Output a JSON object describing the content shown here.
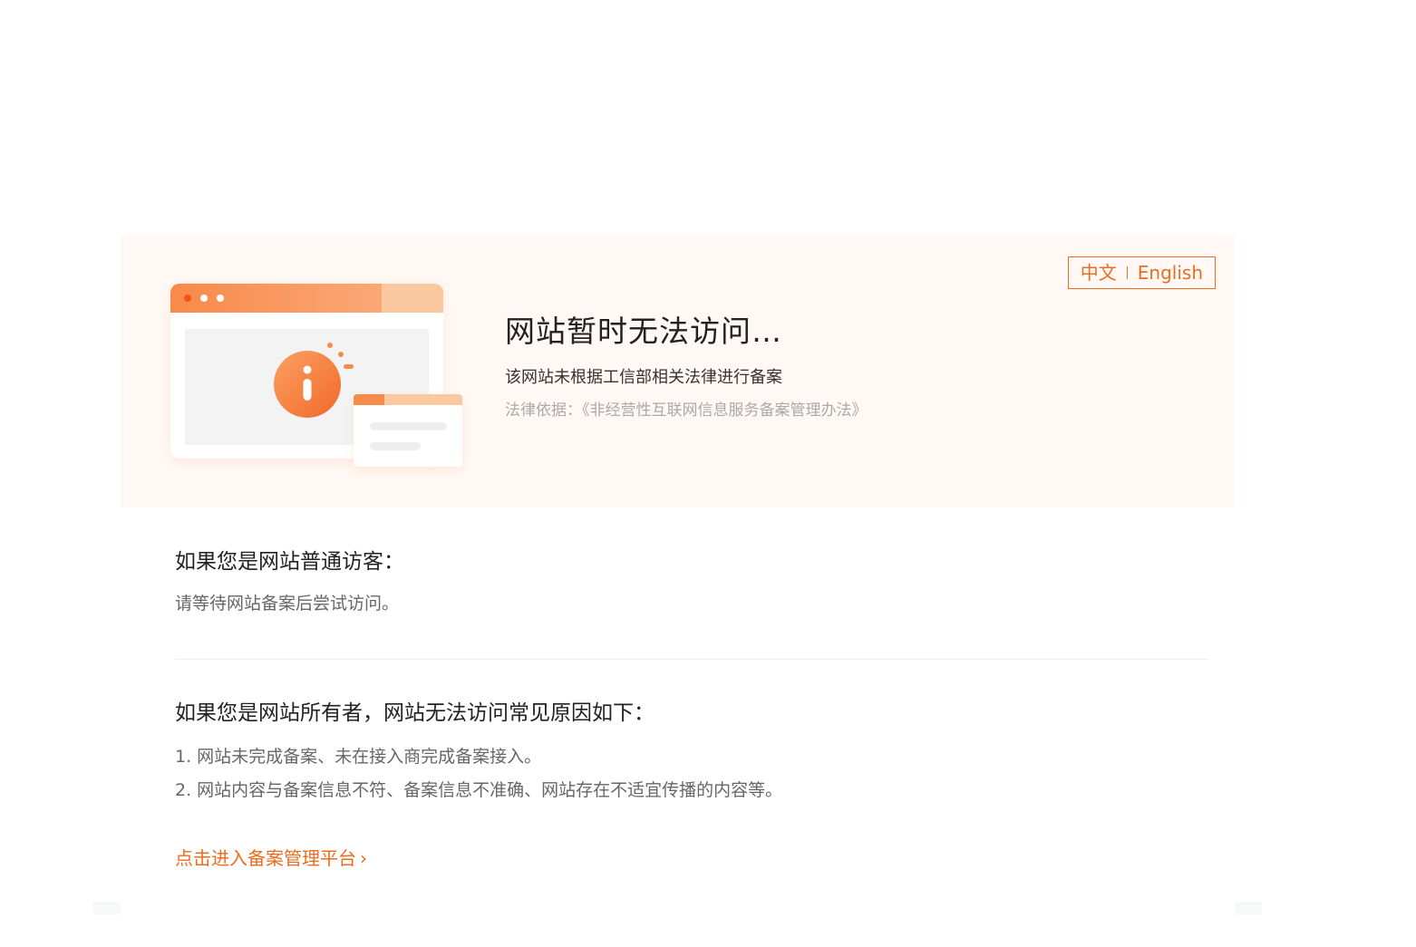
{
  "lang_switch": {
    "zh": "中文",
    "en": "English"
  },
  "banner": {
    "title": "网站暂时无法访问…",
    "subtitle": "该网站未根据工信部相关法律进行备案",
    "law": "法律依据：《非经营性互联网信息服务备案管理办法》"
  },
  "visitor": {
    "heading": "如果您是网站普通访客：",
    "text": "请等待网站备案后尝试访问。"
  },
  "owner": {
    "heading": "如果您是网站所有者，网站无法访问常见原因如下：",
    "reasons": [
      "1. 网站未完成备案、未在接入商完成备案接入。",
      "2. 网站内容与备案信息不符、备案信息不准确、网站存在不适宜传播的内容等。"
    ]
  },
  "link": {
    "label": "点击进入备案管理平台",
    "chevron": "›"
  },
  "colors": {
    "accent": "#ed6c1f",
    "banner_bg": "#fff8f4",
    "illustration_light": "#fcc8a0",
    "illustration_dark": "#f78b4a"
  },
  "icons": {
    "illustration": "browser-window-info-icon",
    "chevron": "chevron-right-icon"
  }
}
